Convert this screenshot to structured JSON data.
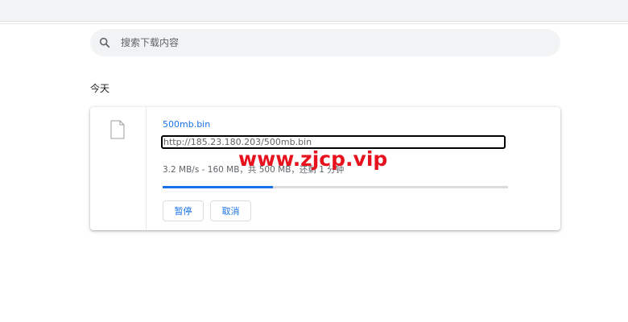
{
  "search": {
    "placeholder": "搜索下载内容"
  },
  "section": {
    "title": "今天"
  },
  "download": {
    "file_name": "500mb.bin",
    "url": "http://185.23.180.203/500mb.bin",
    "status": "3.2 MB/s - 160 MB，共 500 MB，还剩 1 分钟",
    "progress": 0.32,
    "pause_label": "暂停",
    "cancel_label": "取消"
  },
  "watermark": {
    "text": "www.zjcp.vip"
  },
  "icons": {
    "search": "search-icon",
    "file": "file-icon"
  },
  "colors": {
    "accent": "#1a73e8",
    "watermark": "#e8121e",
    "search_bg": "#f1f3f4",
    "track": "#dadce0"
  }
}
